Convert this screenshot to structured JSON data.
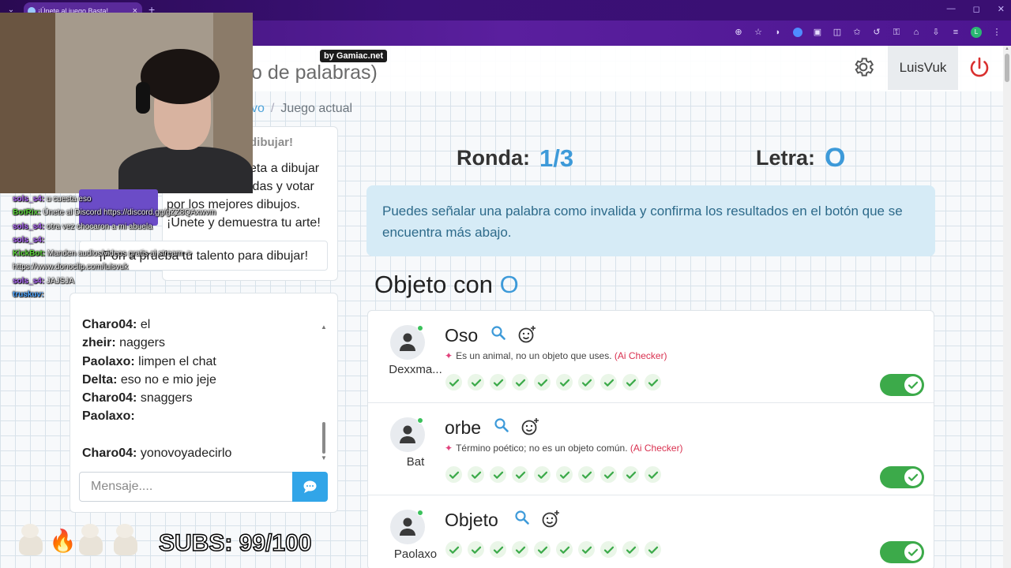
{
  "browser": {
    "tab_title": "¡Únete al juego Basta!",
    "close_glyph": "×",
    "new_tab_glyph": "+",
    "window_controls": [
      "—",
      "◻",
      "✕"
    ]
  },
  "header": {
    "title_visible": "o de palabras)",
    "username": "LuisVuk"
  },
  "breadcrumb": {
    "link": "vo",
    "separator": "/",
    "current": "Juego actual"
  },
  "info_card": {
    "heading": "dibujar!",
    "line1": "eta a dibujar",
    "line2": "idas y votar",
    "line3": "por los mejores dibujos.",
    "line4": "¡Únete y demuestra tu arte!",
    "promo": "¡Pon a prueba tu talento para dibujar!"
  },
  "chat": {
    "messages": [
      {
        "user": "Charo04:",
        "text": "el"
      },
      {
        "user": "zheir:",
        "text": "naggers"
      },
      {
        "user": "Paolaxo:",
        "text": "limpen el chat"
      },
      {
        "user": "Delta:",
        "text": "eso no e mio jeje"
      },
      {
        "user": "Charo04:",
        "text": "snaggers"
      },
      {
        "user": "Paolaxo:",
        "text": ""
      },
      {
        "user": "",
        "text": ""
      },
      {
        "user": "Charo04:",
        "text": "yonovoyadecirlo"
      }
    ],
    "input_placeholder": "Mensaje...."
  },
  "game": {
    "round_label": "Ronda:",
    "round_value": "1/3",
    "letter_label": "Letra:",
    "letter_value": "O",
    "alert": "Puedes señalar una palabra como invalida y confirma los resultados en el botón que se encuentra más abajo.",
    "category_prefix": "Objeto con",
    "category_letter": "O",
    "answers": [
      {
        "player": "Dexxma...",
        "word": "Oso",
        "checker": "Es un animal, no un objeto que uses.",
        "checker_tag": "(Ai Checker)",
        "votes": 10,
        "valid": true
      },
      {
        "player": "Bat",
        "word": "orbe",
        "checker": "Término poético; no es un objeto común.",
        "checker_tag": "(Ai Checker)",
        "votes": 10,
        "valid": true
      },
      {
        "player": "Paolaxo",
        "word": "Objeto",
        "checker": "",
        "checker_tag": "",
        "votes": 10,
        "valid": true
      }
    ],
    "accent_color": "#3d9ad9",
    "toggle_color": "#3caa4a"
  },
  "overlay": {
    "credit": "by Gamiac.net",
    "twitch_chat": [
      {
        "user": "sols_s4:",
        "text": "u cuesta eso"
      },
      {
        "user": "BotRix:",
        "text": "Únete al Discord https://discord.gg/gZZ8QAxwvm"
      },
      {
        "user": "sols_s4:",
        "text": "otra vez chocaron a mi abuela"
      },
      {
        "user": "sols_s4:",
        "text": ""
      },
      {
        "user": "KickBot:",
        "text": "Manden audios/videos gratis al stream -> https://www.donoclip.com/luisvuk"
      },
      {
        "user": "sols_s4:",
        "text": "JAJSJA"
      },
      {
        "user": "truskuv:",
        "text": ""
      }
    ],
    "subs": "SUBS: 99/100"
  }
}
